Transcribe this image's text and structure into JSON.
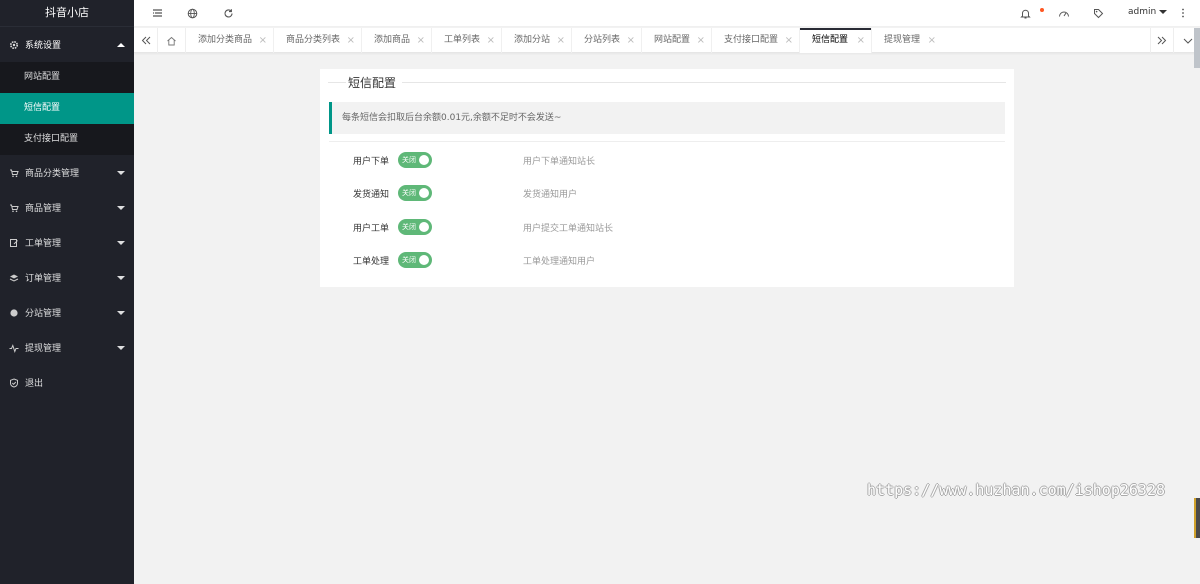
{
  "sidebar": {
    "logo": "抖音小店",
    "menu": [
      {
        "label": "系统设置",
        "icon": "gear-icon",
        "open": true
      },
      {
        "label": "商品分类管理",
        "icon": "cart-icon"
      },
      {
        "label": "商品管理",
        "icon": "cart-icon"
      },
      {
        "label": "工单管理",
        "icon": "edit-icon"
      },
      {
        "label": "订单管理",
        "icon": "layers-icon"
      },
      {
        "label": "分站管理",
        "icon": "globe-icon"
      },
      {
        "label": "提现管理",
        "icon": "pulse-icon"
      },
      {
        "label": "退出",
        "icon": "shield-icon"
      }
    ],
    "submenu": [
      {
        "label": "网站配置"
      },
      {
        "label": "短信配置",
        "active": true
      },
      {
        "label": "支付接口配置"
      }
    ]
  },
  "header": {
    "user": "admin"
  },
  "tabs": [
    {
      "label": "添加分类商品"
    },
    {
      "label": "商品分类列表"
    },
    {
      "label": "添加商品"
    },
    {
      "label": "工单列表"
    },
    {
      "label": "添加分站"
    },
    {
      "label": "分站列表"
    },
    {
      "label": "网站配置"
    },
    {
      "label": "支付接口配置"
    },
    {
      "label": "短信配置",
      "active": true
    },
    {
      "label": "提现管理"
    }
  ],
  "content": {
    "title": "短信配置",
    "notice": "每条短信会扣取后台余额0.01元,余额不足时不会发送~",
    "rows": [
      {
        "label": "用户下单",
        "switch_text": "关闭",
        "desc": "用户下单通知站长"
      },
      {
        "label": "发货通知",
        "switch_text": "关闭",
        "desc": "发货通知用户"
      },
      {
        "label": "用户工单",
        "switch_text": "关闭",
        "desc": "用户提交工单通知站长"
      },
      {
        "label": "工单处理",
        "switch_text": "关闭",
        "desc": "工单处理通知用户"
      }
    ]
  },
  "watermark": "https://www.huzhan.com/ishop26328",
  "colors": {
    "accent": "#009688",
    "switch_on": "#5fb878",
    "sidebar_bg": "#20222a"
  }
}
